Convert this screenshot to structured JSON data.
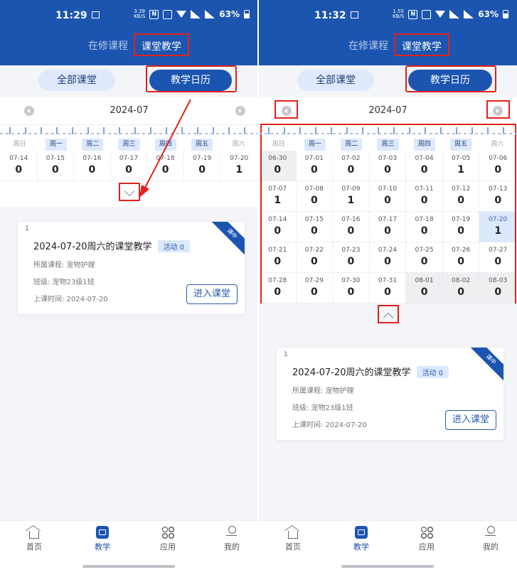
{
  "screens": [
    {
      "status": {
        "time": "11:29",
        "speed_top": "3.39",
        "speed_bottom": "KB/S",
        "nfc": "N",
        "battery": "63%"
      },
      "header": {
        "tab_inactive": "在修课程",
        "tab_active": "课堂教学"
      },
      "segments": {
        "all": "全部课堂",
        "calendar": "教学日历"
      },
      "month": "2024-07",
      "weekdays": [
        "周日",
        "周一",
        "周二",
        "周三",
        "周四",
        "周五",
        "周六"
      ],
      "days": [
        {
          "d": "07-14",
          "n": "0"
        },
        {
          "d": "07-15",
          "n": "0"
        },
        {
          "d": "07-16",
          "n": "0"
        },
        {
          "d": "07-17",
          "n": "0"
        },
        {
          "d": "07-18",
          "n": "0"
        },
        {
          "d": "07-19",
          "n": "0"
        },
        {
          "d": "07-20",
          "n": "1"
        }
      ],
      "card": {
        "index": "1",
        "title": "2024-07-20周六的课堂教学",
        "activity": "活动 0",
        "course": "所属课程: 宠物护理",
        "class": "班级: 宠物23级1班",
        "time": "上课时间: 2024-07-20",
        "ribbon": "课中",
        "enter": "进入课堂"
      },
      "tabs": [
        "首页",
        "教学",
        "应用",
        "我的"
      ]
    },
    {
      "status": {
        "time": "11:32",
        "speed_top": "1.55",
        "speed_bottom": "KB/S",
        "nfc": "N",
        "battery": "63%"
      },
      "header": {
        "tab_inactive": "在修课程",
        "tab_active": "课堂教学"
      },
      "segments": {
        "all": "全部课堂",
        "calendar": "教学日历"
      },
      "month": "2024-07",
      "weekdays": [
        "周日",
        "周一",
        "周二",
        "周三",
        "周四",
        "周五",
        "周六"
      ],
      "days": [
        {
          "d": "06-30",
          "n": "0",
          "out": true
        },
        {
          "d": "07-01",
          "n": "0"
        },
        {
          "d": "07-02",
          "n": "0"
        },
        {
          "d": "07-03",
          "n": "0"
        },
        {
          "d": "07-04",
          "n": "0"
        },
        {
          "d": "07-05",
          "n": "1"
        },
        {
          "d": "07-06",
          "n": "0"
        },
        {
          "d": "07-07",
          "n": "1"
        },
        {
          "d": "07-08",
          "n": "0"
        },
        {
          "d": "07-09",
          "n": "1"
        },
        {
          "d": "07-10",
          "n": "0"
        },
        {
          "d": "07-11",
          "n": "0"
        },
        {
          "d": "07-12",
          "n": "0"
        },
        {
          "d": "07-13",
          "n": "0"
        },
        {
          "d": "07-14",
          "n": "0"
        },
        {
          "d": "07-15",
          "n": "0"
        },
        {
          "d": "07-16",
          "n": "0"
        },
        {
          "d": "07-17",
          "n": "0"
        },
        {
          "d": "07-18",
          "n": "0"
        },
        {
          "d": "07-19",
          "n": "0"
        },
        {
          "d": "07-20",
          "n": "1",
          "sel": true
        },
        {
          "d": "07-21",
          "n": "0"
        },
        {
          "d": "07-22",
          "n": "0"
        },
        {
          "d": "07-23",
          "n": "0"
        },
        {
          "d": "07-24",
          "n": "0"
        },
        {
          "d": "07-25",
          "n": "0"
        },
        {
          "d": "07-26",
          "n": "0"
        },
        {
          "d": "07-27",
          "n": "0"
        },
        {
          "d": "07-28",
          "n": "0"
        },
        {
          "d": "07-29",
          "n": "0"
        },
        {
          "d": "07-30",
          "n": "0"
        },
        {
          "d": "07-31",
          "n": "0"
        },
        {
          "d": "08-01",
          "n": "0",
          "out": true
        },
        {
          "d": "08-02",
          "n": "0",
          "out": true
        },
        {
          "d": "08-03",
          "n": "0",
          "out": true
        }
      ],
      "card": {
        "index": "1",
        "title": "2024-07-20周六的课堂教学",
        "activity": "活动 0",
        "course": "所属课程: 宠物护理",
        "class": "班级: 宠物23级1班",
        "time": "上课时间: 2024-07-20",
        "ribbon": "课中",
        "enter": "进入课堂"
      },
      "tabs": [
        "首页",
        "教学",
        "应用",
        "我的"
      ]
    }
  ],
  "colors": {
    "primary": "#1c55b0",
    "highlight_box": "#e2211c"
  }
}
